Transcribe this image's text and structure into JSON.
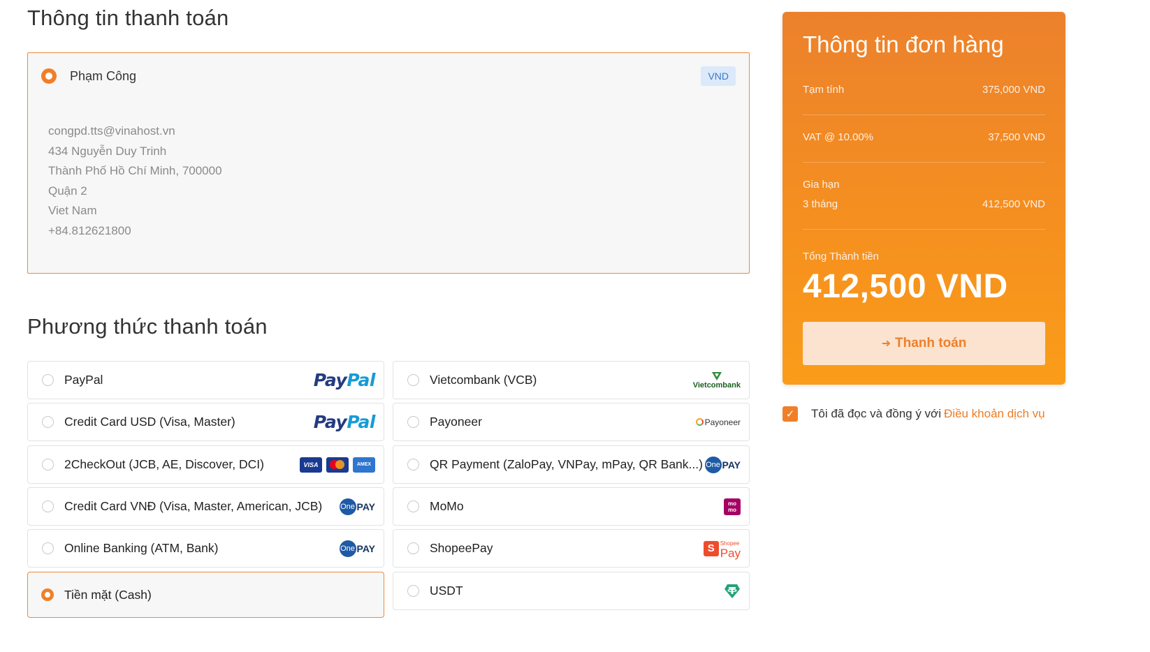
{
  "billing": {
    "title": "Thông tin thanh toán",
    "name": "Phạm Công",
    "currency": "VND",
    "lines": [
      "congpd.tts@vinahost.vn",
      "434 Nguyễn Duy Trinh",
      "Thành Phố Hồ Chí Minh, 700000",
      "Quận 2",
      "Viet Nam",
      "+84.812621800"
    ]
  },
  "payment": {
    "title": "Phương thức thanh toán",
    "methods": [
      {
        "label": "PayPal",
        "logo": "paypal-logo",
        "selected": false
      },
      {
        "label": "Vietcombank (VCB)",
        "logo": "vietcombank-logo",
        "selected": false
      },
      {
        "label": "Credit Card USD (Visa, Master)",
        "logo": "paypal-logo",
        "selected": false
      },
      {
        "label": "Payoneer",
        "logo": "payoneer-logo",
        "selected": false
      },
      {
        "label": "2CheckOut (JCB, AE, Discover, DCI)",
        "logo": "card-brands-logo",
        "selected": false
      },
      {
        "label": "QR Payment (ZaloPay, VNPay, mPay, QR Bank...)",
        "logo": "onepay-logo",
        "selected": false
      },
      {
        "label": "Credit Card VNĐ (Visa, Master, American, JCB)",
        "logo": "onepay-logo",
        "selected": false
      },
      {
        "label": "MoMo",
        "logo": "momo-logo",
        "selected": false
      },
      {
        "label": "Online Banking (ATM, Bank)",
        "logo": "onepay-logo",
        "selected": false
      },
      {
        "label": "ShopeePay",
        "logo": "shopeepay-logo",
        "selected": false
      },
      {
        "label": "Tiền mặt (Cash)",
        "logo": "",
        "selected": true
      },
      {
        "label": "USDT",
        "logo": "tether-logo",
        "selected": false
      }
    ],
    "logo_text": {
      "paypal_1": "Pay",
      "paypal_2": "Pal",
      "vietcombank": "Vietcombank",
      "payoneer": "Payoneer",
      "onepay_circle": "One",
      "onepay_text": "PAY",
      "visa": "VISA",
      "amex": "AMEX",
      "momo_1": "mo",
      "momo_2": "mo",
      "shopee_bag": "S",
      "shopee_small": "Shopee",
      "shopee_pay": "Pay"
    }
  },
  "order": {
    "title": "Thông tin đơn hàng",
    "subtotal_label": "Tạm tính",
    "subtotal_value": "375,000 VND",
    "vat_label": "VAT @ 10.00%",
    "vat_value": "37,500 VND",
    "renewal_label": "Gia hạn",
    "renewal_period": "3 tháng",
    "renewal_value": "412,500 VND",
    "total_label": "Tổng Thành tiền",
    "total_value": "412,500 VND",
    "pay_button": "Thanh toán"
  },
  "terms": {
    "checked": true,
    "text": "Tôi đã đọc và đồng ý với",
    "link": "Điều khoản dịch vụ"
  },
  "colors": {
    "accent": "#f07f29",
    "order_gradient_top": "#ec812c",
    "order_gradient_bottom": "#fa9d1a"
  }
}
